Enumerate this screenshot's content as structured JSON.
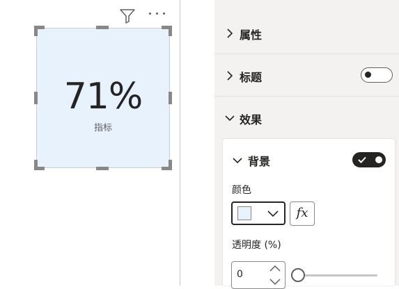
{
  "visual": {
    "card_value": "71%",
    "card_label": "指标",
    "icons": [
      "filter-icon",
      "more-options-icon"
    ],
    "card_background": "#e8f2fd"
  },
  "format_pane": {
    "sections": [
      {
        "label": "属性",
        "expanded": false
      },
      {
        "label": "标题",
        "expanded": false,
        "toggle_on": false
      },
      {
        "label": "效果",
        "expanded": true
      }
    ],
    "background": {
      "title": "背景",
      "toggle_on": true,
      "color_label": "颜色",
      "color_value": "#e8f2fd",
      "fx_label": "fx",
      "transparency_label": "透明度 (%)",
      "transparency_value": "0",
      "transparency_slider_percent": 0
    }
  }
}
